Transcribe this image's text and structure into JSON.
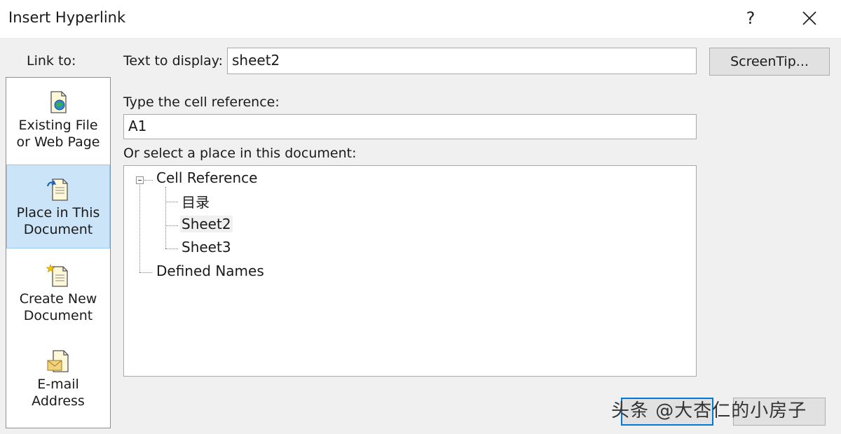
{
  "window": {
    "title": "Insert Hyperlink",
    "help_label": "?"
  },
  "link_to": {
    "label": "Link to:",
    "items": [
      {
        "line1": "Existing File",
        "line2": "or Web Page"
      },
      {
        "line1": "Place in This",
        "line2": "Document"
      },
      {
        "line1": "Create New",
        "line2": "Document"
      },
      {
        "line1": "E-mail",
        "line2": "Address"
      }
    ]
  },
  "form": {
    "text_to_display_label": "Text to display:",
    "text_to_display_value": "sheet2",
    "screentip_label": "ScreenTip...",
    "cell_ref_label": "Type the cell reference:",
    "cell_ref_value": "A1",
    "place_label": "Or select a place in this document:"
  },
  "tree": {
    "root": "Cell Reference",
    "children": [
      "目录",
      "Sheet2",
      "Sheet3"
    ],
    "selected": "Sheet2",
    "defined_names": "Defined Names"
  },
  "watermark": "头条 @大杏仁的小房子",
  "colors": {
    "selected_bg": "#cce4f7",
    "focus_border": "#0078d7"
  }
}
